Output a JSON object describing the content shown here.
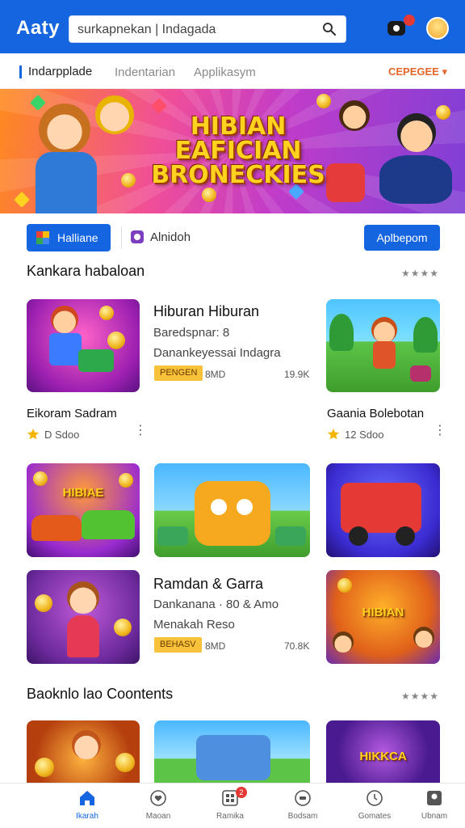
{
  "header": {
    "logo": "Aaty",
    "search_value": "surkapnekan | Indagada",
    "notification_count": "",
    "brand_color": "#1565e0"
  },
  "subnav": {
    "items": [
      "Indarpplade",
      "Indentarian",
      "Applikasym"
    ],
    "more_label": "CEPEGEE"
  },
  "banner": {
    "title_line1": "HIBIAN",
    "title_line2": "EAFICIAN",
    "title_line3": "BRONECKIES"
  },
  "filters": {
    "primary_label": "Halliane",
    "secondary_label": "Alnidoh",
    "apply_label": "Aplbepom"
  },
  "section1": {
    "title": "Kankara habaloan",
    "more": "★★★★"
  },
  "featured1": {
    "title": "Hiburan Hiburan",
    "line1": "Baredspnar: 8",
    "line2": "Danankeyessai Indagra",
    "tag": "PENGEN",
    "size": "8MD",
    "count": "19.9K"
  },
  "cards_row1": [
    {
      "name": "Eikoram Sadram",
      "rating": "D Sdoo"
    },
    {
      "name": "Gaania Bolebotan",
      "rating": "12 Sdoo"
    }
  ],
  "featured2": {
    "title": "Ramdan & Garra",
    "line1": "Dankanana · 80 & Amo",
    "line2": "Menakah Reso",
    "tag": "BEHASV",
    "size": "8MD",
    "count": "70.8K"
  },
  "thumb_labels": {
    "race_title": "HIBIAE",
    "arcade_title": "HIBIAN",
    "bottom_title": "HIKKCA"
  },
  "section2": {
    "title": "Baoknlo lao Coontents",
    "more": "★★★★"
  },
  "bottom_nav": [
    {
      "label": "Ikarah",
      "icon": "home-icon"
    },
    {
      "label": "Maoan",
      "icon": "heart-icon"
    },
    {
      "label": "Ramika",
      "icon": "grid-icon",
      "badge": "2"
    },
    {
      "label": "Bodsam",
      "icon": "ticket-icon"
    },
    {
      "label": "Gomates",
      "icon": "clock-icon"
    },
    {
      "label": "Ubnam",
      "icon": "profile-icon"
    }
  ]
}
